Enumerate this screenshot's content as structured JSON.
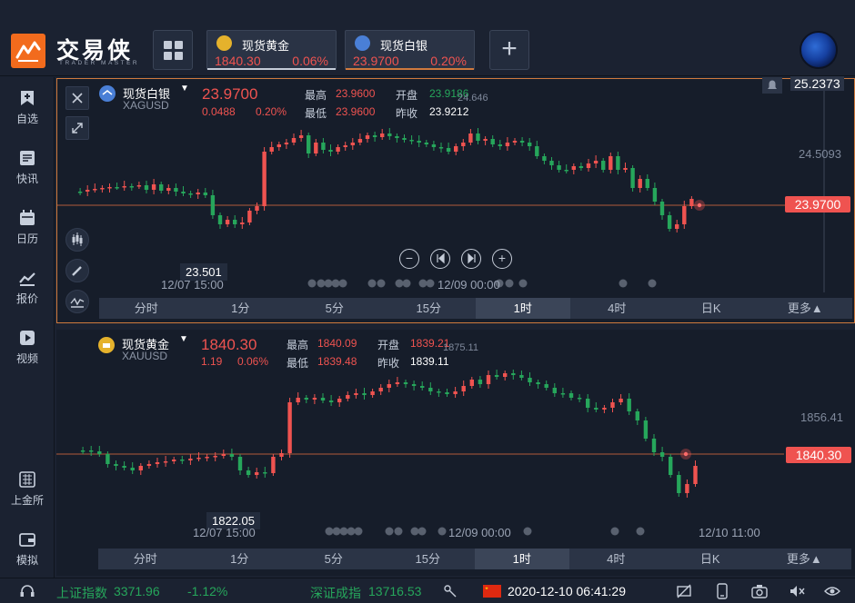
{
  "window": {
    "controls": [
      "◈",
      "—",
      "☐",
      "✕"
    ]
  },
  "brand": {
    "name": "交易侠",
    "sub": "TRADER MASTER"
  },
  "quote_tabs": [
    {
      "name": "现货黄金",
      "price": "1840.30",
      "change": "0.06%",
      "underline": "#c5ccd8",
      "coin": "#e5b22c"
    },
    {
      "name": "现货白银",
      "price": "23.9700",
      "change": "0.20%",
      "underline": "#d07a3e",
      "coin": "#4a7fd6"
    }
  ],
  "sidebar": {
    "items": [
      {
        "label": "自选",
        "icon": "bookmark-icon"
      },
      {
        "label": "快讯",
        "icon": "news-icon"
      },
      {
        "label": "日历",
        "icon": "calendar-icon"
      },
      {
        "label": "报价",
        "icon": "line-chart-icon"
      },
      {
        "label": "视频",
        "icon": "play-icon"
      },
      {
        "label": "上金所",
        "icon": "exchange-icon"
      },
      {
        "label": "模拟",
        "icon": "wallet-icon"
      }
    ]
  },
  "timeframes": [
    "分时",
    "1分",
    "5分",
    "15分",
    "1时",
    "4时",
    "日K",
    "更多▲"
  ],
  "active_timeframe": "1时",
  "panel1": {
    "name": "现货白银",
    "dropdown": "▼",
    "code": "XAGUSD",
    "price": "23.9700",
    "change": "0.0488",
    "change_pct": "0.20%",
    "high_label": "最高",
    "high": "23.9600",
    "open_label": "开盘",
    "open": "23.9186",
    "low_label": "最低",
    "low": "23.9600",
    "prev_label": "昨收",
    "prev": "23.9212",
    "top_right": "25.2373",
    "axis_mid": "24.5093",
    "hover_peak": "24.646",
    "price_tag": "23.9700",
    "low_tag": "23.501",
    "time_left": "12/07 15:00",
    "time_mid": "12/09 00:00"
  },
  "panel2": {
    "name": "现货黄金",
    "dropdown": "▼",
    "code": "XAUUSD",
    "price": "1840.30",
    "change": "1.19",
    "change_pct": "0.06%",
    "high_label": "最高",
    "high": "1840.09",
    "open_label": "开盘",
    "open": "1839.21",
    "low_label": "最低",
    "low": "1839.48",
    "prev_label": "昨收",
    "prev": "1839.11",
    "axis_mid": "1856.41",
    "hover_peak": "1875.11",
    "price_tag": "1840.30",
    "low_tag": "1822.05",
    "time_left": "12/07 15:00",
    "time_mid": "12/09 00:00",
    "time_right": "12/10 11:00"
  },
  "status": {
    "index1_name": "上证指数",
    "index1_value": "3371.96",
    "index1_change": "-1.12%",
    "index2_name": "深证成指",
    "index2_value": "13716.53",
    "datetime": "2020-12-10 06:41:29"
  },
  "colors": {
    "up": "#26a65b",
    "down": "#ef5350",
    "accent": "#d07a3e",
    "bg": "#161d2a"
  }
}
